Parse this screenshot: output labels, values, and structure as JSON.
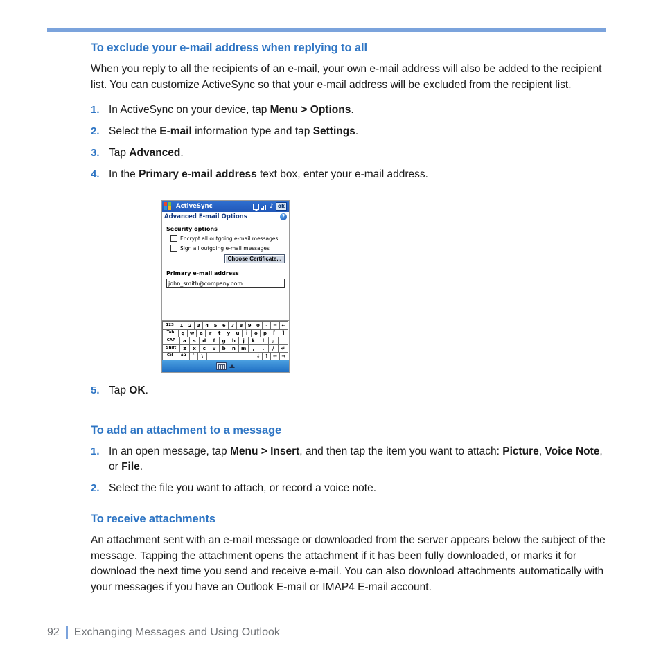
{
  "page": {
    "number": "92",
    "footer_title": "Exchanging Messages and Using Outlook"
  },
  "section1": {
    "heading": "To exclude your e-mail address when replying to all",
    "paragraph": "When you reply to all the recipients of an e-mail, your own e-mail address will also be added to the recipient list. You can customize ActiveSync so that your e-mail address will be excluded from the recipient list.",
    "steps": [
      {
        "num": "1.",
        "html": "In ActiveSync on your device, tap <b>Menu &gt; Options</b>."
      },
      {
        "num": "2.",
        "html": "Select the <b>E-mail</b> information type and tap <b>Settings</b>."
      },
      {
        "num": "3.",
        "html": "Tap <b>Advanced</b>."
      },
      {
        "num": "4.",
        "html": "In the <b>Primary e-mail address</b> text box, enter your e-mail address."
      }
    ],
    "step5": {
      "num": "5.",
      "html": "Tap <b>OK</b>."
    }
  },
  "device": {
    "app_title": "ActiveSync",
    "ok_label": "ok",
    "subtitle": "Advanced E-mail Options",
    "help_label": "?",
    "group_label": "Security options",
    "checkbox1": "Encrypt all outgoing e-mail messages",
    "checkbox2": "Sign all outgoing e-mail messages",
    "button_label": "Choose Certificate...",
    "field_label": "Primary e-mail address",
    "field_value": "john_smith@company.com",
    "keyboard": {
      "row1": [
        "123",
        "1",
        "2",
        "3",
        "4",
        "5",
        "6",
        "7",
        "8",
        "9",
        "0",
        "-",
        "=",
        "←"
      ],
      "row2": [
        "Tab",
        "q",
        "w",
        "e",
        "r",
        "t",
        "y",
        "u",
        "i",
        "o",
        "p",
        "[",
        "]"
      ],
      "row3": [
        "CAP",
        "a",
        "s",
        "d",
        "f",
        "g",
        "h",
        "j",
        "k",
        "l",
        ";",
        "'"
      ],
      "row4": [
        "Shift",
        "z",
        "x",
        "c",
        "v",
        "b",
        "n",
        "m",
        ",",
        ".",
        "/",
        "↵"
      ],
      "row5": [
        "Ctl",
        "áü",
        "`",
        "\\",
        "",
        "↓",
        "↑",
        "←",
        "→"
      ]
    }
  },
  "section2": {
    "heading": "To add an attachment to a message",
    "steps": [
      {
        "num": "1.",
        "html": "In an open message, tap <b>Menu &gt; Insert</b>, and then tap the item you want to attach: <b>Picture</b>, <b>Voice Note</b>, or <b>File</b>."
      },
      {
        "num": "2.",
        "html": "Select the file you want to attach, or record a voice note."
      }
    ]
  },
  "section3": {
    "heading": "To receive attachments",
    "paragraph": "An attachment sent with an e-mail message or downloaded from the server appears below the subject of the message. Tapping the attachment opens the attachment if it has been fully downloaded, or marks it for download the next time you send and receive e-mail. You can also download attachments automatically with your messages if you have an Outlook E-mail or IMAP4 E-mail account."
  }
}
